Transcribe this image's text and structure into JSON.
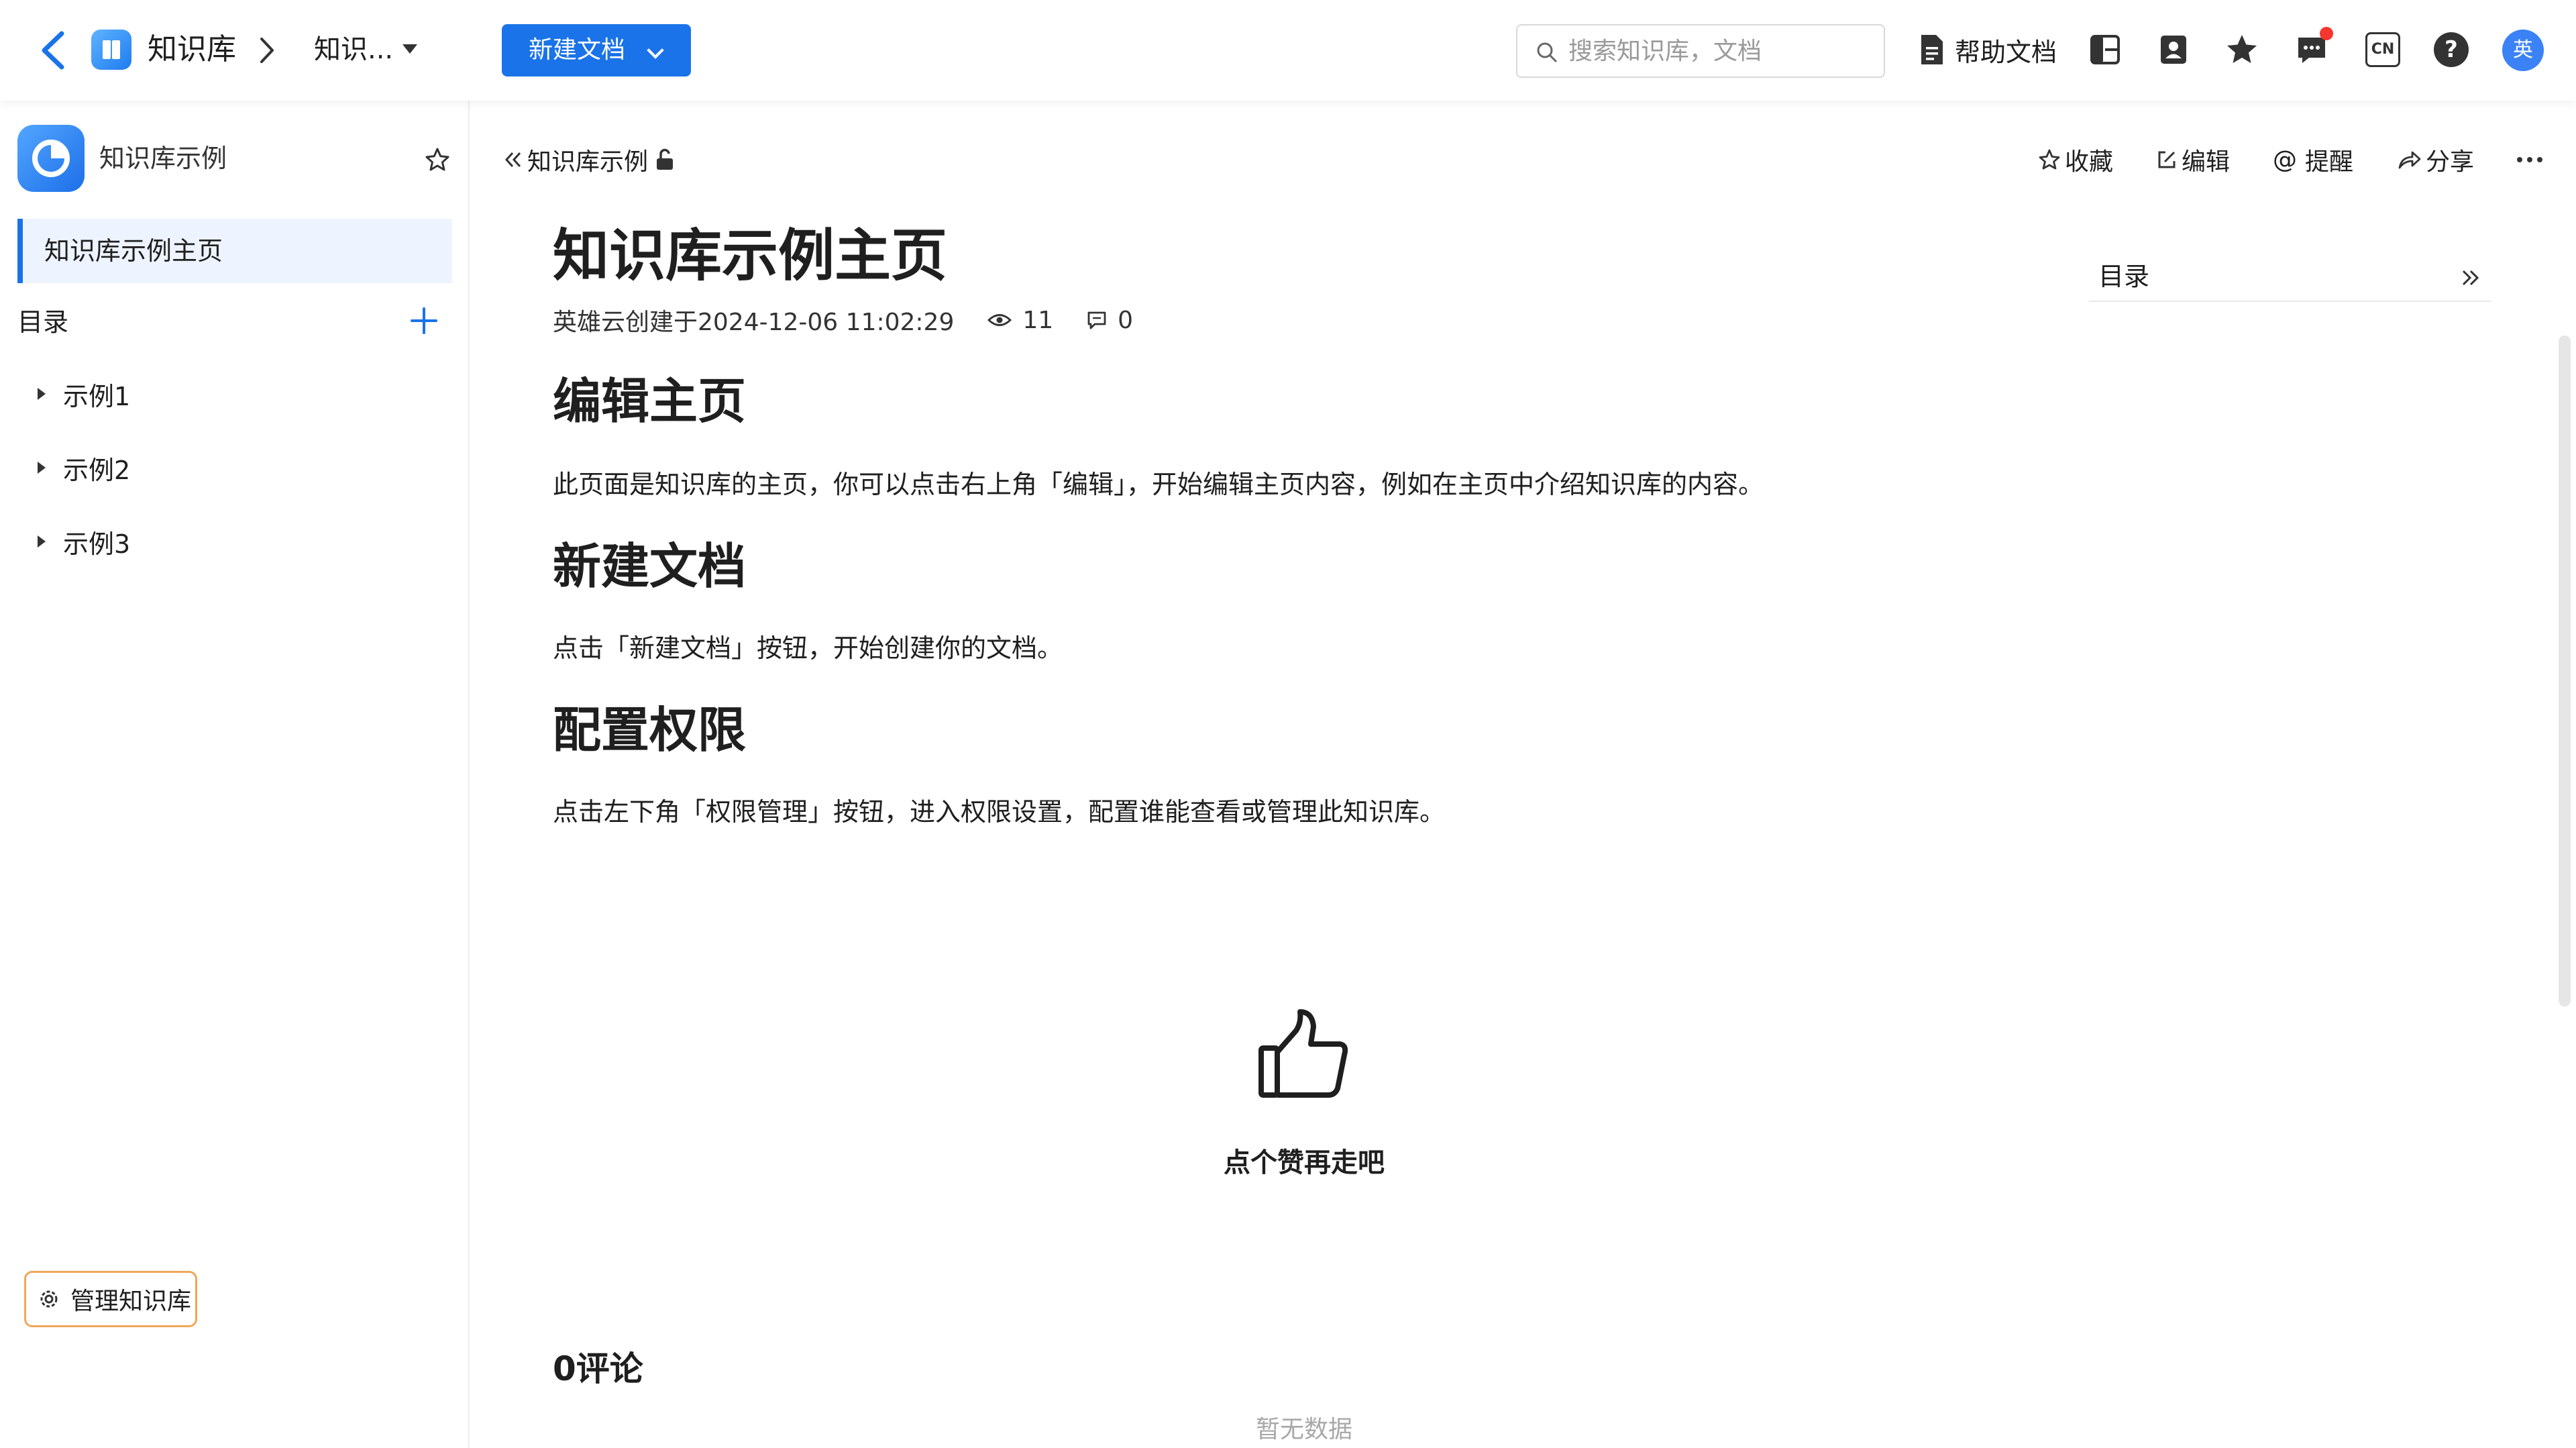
{
  "topbar": {
    "app_name": "知识库",
    "breadcrumb_doc": "知识...",
    "new_doc_label": "新建文档",
    "search_placeholder": "搜索知识库，文档",
    "help_doc_label": "帮助文档",
    "lang_label": "CN",
    "help_label": "?",
    "avatar_label": "英",
    "notification_dot_color": "#f5372f"
  },
  "sidebar": {
    "kb_title": "知识库示例",
    "home_item": "知识库示例主页",
    "toc_label": "目录",
    "items": [
      "示例1",
      "示例2",
      "示例3"
    ],
    "manage_label": "管理知识库"
  },
  "doc": {
    "header_crumb": "知识库示例",
    "actions": {
      "favorite": "收藏",
      "edit": "编辑",
      "remind": "提醒",
      "share": "分享"
    },
    "title": "知识库示例主页",
    "meta": {
      "created": "英雄云创建于2024-12-06 11:02:29",
      "views": "11",
      "comments": "0"
    },
    "sections": [
      {
        "heading": "编辑主页",
        "text": "此页面是知识库的主页，你可以点击右上角「编辑」，开始编辑主页内容，例如在主页中介绍知识库的内容。"
      },
      {
        "heading": "新建文档",
        "text": "点击「新建文档」按钮，开始创建你的文档。"
      },
      {
        "heading": "配置权限",
        "text": "点击左下角「权限管理」按钮，进入权限设置，配置谁能查看或管理此知识库。"
      }
    ],
    "toc_panel_label": "目录",
    "like_text": "点个赞再走吧",
    "comments_title": "0评论",
    "empty_text": "暂无数据"
  },
  "colors": {
    "accent": "#1a73e8",
    "active_item_bg": "#eef4ff",
    "manage_border": "#f0a858"
  }
}
